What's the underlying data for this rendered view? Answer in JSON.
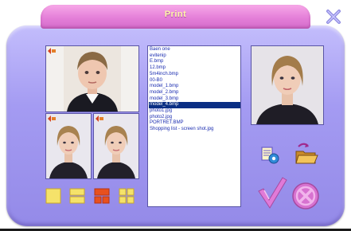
{
  "window": {
    "title": "Print"
  },
  "files": [
    "Baen one",
    "evitenip",
    "E.bmp",
    "12.bmp",
    "5m4inch.bmp",
    "00-B0",
    "model_1.bmp",
    "model_2.bmp",
    "model_3.bmp",
    "model_4.bmp",
    "photo1.jpg",
    "photo2.jpg",
    "PORTRET.BMP",
    "Shopping list - screen shot.jpg"
  ],
  "selected_file_index": 9,
  "colors": {
    "frame": "#a49bf2",
    "title_tab": "#e47fd8",
    "title_text": "#fff6a8",
    "layout_active": "#e8501e",
    "layout_inactive": "#f5e26a",
    "ok_check": "#e07ad8",
    "cancel": "#e07ad8",
    "selection": "#0a2f84"
  },
  "icons": {
    "close": "close-icon",
    "ok": "checkmark-icon",
    "cancel": "cancel-circle-icon",
    "printer_settings": "printer-settings-icon",
    "open_folder": "open-folder-icon"
  }
}
